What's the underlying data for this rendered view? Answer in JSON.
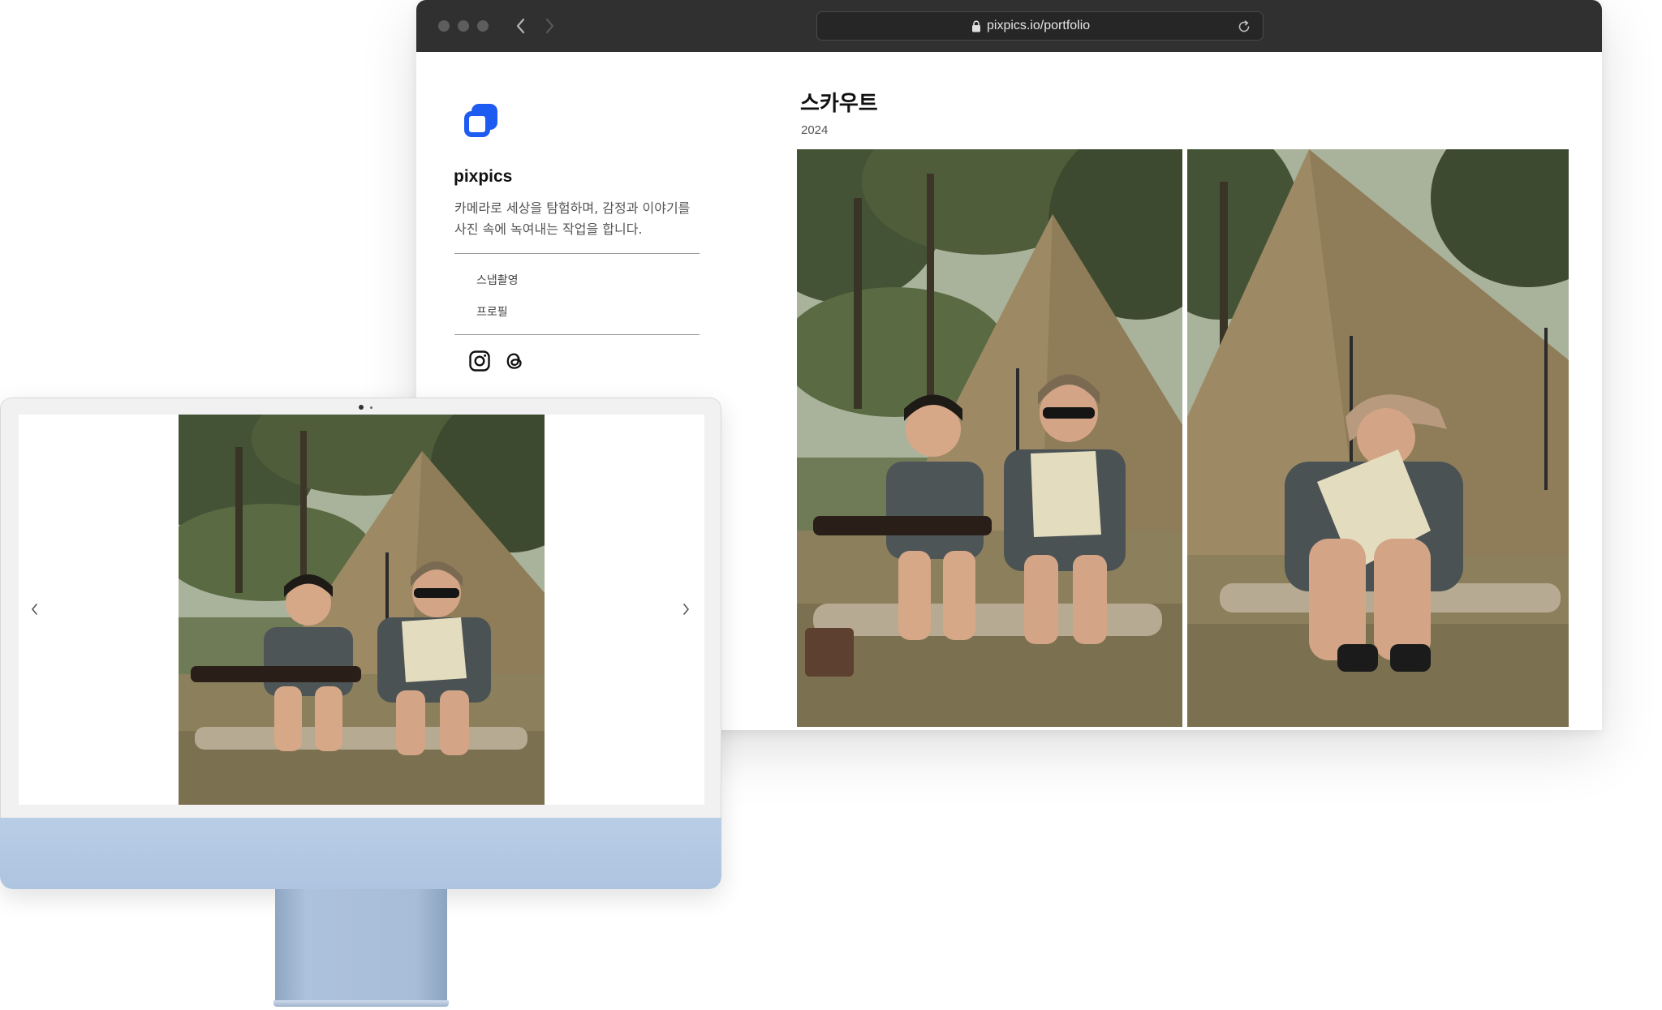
{
  "browser": {
    "url": "pixpics.io/portfolio"
  },
  "sidebar": {
    "brand_name": "pixpics",
    "description": "카메라로 세상을 탐험하며, 감정과 이야기를 사진 속에 녹여내는 작업을 합니다.",
    "menu": [
      {
        "label": "스냅촬영"
      },
      {
        "label": "프로필"
      }
    ],
    "social_icons": [
      "instagram-icon",
      "threads-icon"
    ]
  },
  "post": {
    "title": "스카우트",
    "year": "2024",
    "photos": [
      {
        "subject": "two children sitting in front of a tent"
      },
      {
        "subject": "child reading a book in front of a tent"
      }
    ]
  },
  "imac_screen": {
    "slide_icons": [
      "chevron-left-icon",
      "chevron-right-icon"
    ]
  },
  "colors": {
    "titlebar": "#303030",
    "logo_blue": "#1e5bf0",
    "imac_blue": "#b4c9e3",
    "tent": "#9d8a65",
    "grass": "#8c7f5c",
    "foliage": "#4e5a38"
  }
}
